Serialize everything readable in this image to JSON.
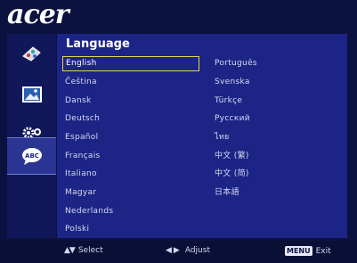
{
  "brand": "acer",
  "menu": {
    "title": "Language",
    "selected": "English",
    "languages_col1": [
      "English",
      "Čeština",
      "Dansk",
      "Deutsch",
      "Español",
      "Français",
      "Italiano",
      "Magyar",
      "Nederlands",
      "Polski"
    ],
    "languages_col2": [
      "Português",
      "Svenska",
      "Türkçe",
      "Русский",
      "ไทย",
      "中文 (繁)",
      "中文 (简)",
      "日本語"
    ]
  },
  "sidebar": {
    "icons": [
      "color-wheel-icon",
      "image-icon",
      "settings-gears-icon",
      "language-bubble-icon"
    ],
    "active_index": 3
  },
  "footer": {
    "select_label": "Select",
    "adjust_label": "Adjust",
    "menu_key": "MENU",
    "exit_label": "Exit"
  },
  "colors": {
    "background": "#0c1240",
    "panel": "#1c2585",
    "highlight": "#e7d44a"
  }
}
